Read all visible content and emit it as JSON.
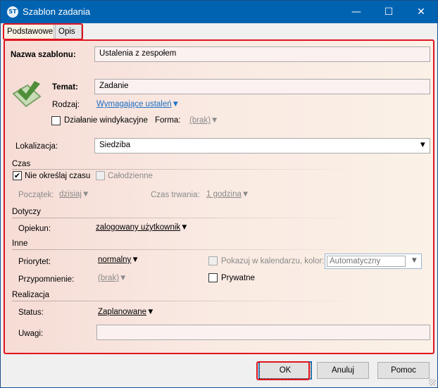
{
  "window": {
    "title": "Szablon zadania",
    "app_icon": "app-logo-icon",
    "minimize": "minimize-icon",
    "maximize": "maximize-icon",
    "close": "close-icon"
  },
  "tabs": [
    {
      "label": "Podstawowe"
    },
    {
      "label": "Opis"
    }
  ],
  "form": {
    "nazwa_label": "Nazwa szablonu:",
    "nazwa_value": "Ustalenia z zespołem",
    "temat_label": "Temat:",
    "temat_value": "Zadanie",
    "rodzaj_label": "Rodzaj:",
    "rodzaj_value": "Wymagające ustaleń",
    "windykacyjne_label": "Działanie windykacyjne",
    "windykacyjne_checked": false,
    "forma_label": "Forma:",
    "forma_value": "(brak)",
    "lokalizacja_label": "Lokalizacja:",
    "lokalizacja_value": "Siedziba"
  },
  "czas": {
    "header": "Czas",
    "nie_okreslaj_label": "Nie określaj czasu",
    "nie_okreslaj_checked": true,
    "calodzienne_label": "Całodzienne",
    "calodzienne_checked": false,
    "poczatek_label": "Początek:",
    "poczatek_value": "dzisiaj",
    "trwanie_label": "Czas trwania:",
    "trwanie_value": "1 godzina"
  },
  "dotyczy": {
    "header": "Dotyczy",
    "opiekun_label": "Opiekun:",
    "opiekun_value": "zalogowany użytkownik"
  },
  "inne": {
    "header": "Inne",
    "priorytet_label": "Priorytet:",
    "priorytet_value": "normalny",
    "pokazuj_label": "Pokazuj w kalendarzu, kolor:",
    "pokazuj_checked": false,
    "kolor_value": "Automatyczny",
    "przypomnienie_label": "Przypomnienie:",
    "przypomnienie_value": "(brak)",
    "prywatne_label": "Prywatne",
    "prywatne_checked": false
  },
  "realizacja": {
    "header": "Realizacja",
    "status_label": "Status:",
    "status_value": "Zaplanowane",
    "uwagi_label": "Uwagi:",
    "uwagi_value": ""
  },
  "buttons": {
    "ok": "OK",
    "anuluj": "Anuluj",
    "pomoc": "Pomoc"
  },
  "colors": {
    "titlebar": "#0063b1",
    "highlight": "#e0141e",
    "link": "#1a6fc7"
  }
}
